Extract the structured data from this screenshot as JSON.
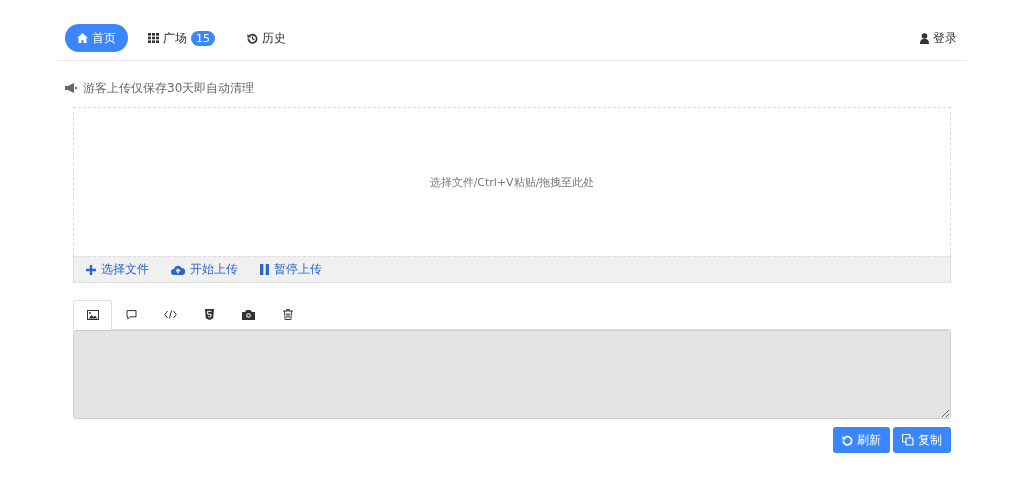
{
  "nav": {
    "items": [
      {
        "kind": "home",
        "label": "首页",
        "selected": true
      },
      {
        "kind": "grid",
        "label": "广场",
        "badge": "15",
        "selected": false
      },
      {
        "kind": "history",
        "label": "历史",
        "selected": false
      }
    ],
    "login": {
      "kind": "user",
      "label": "登录"
    }
  },
  "notice": {
    "kind": "megaphone",
    "text": "游客上传仅保存30天即自动清理"
  },
  "uploader": {
    "hint": "选择文件/Ctrl+V粘贴/拖拽至此处",
    "actions": [
      {
        "kind": "plus",
        "label": "选择文件"
      },
      {
        "kind": "cloud",
        "label": "开始上传"
      },
      {
        "kind": "pause",
        "label": "暂停上传"
      }
    ]
  },
  "tabs": [
    {
      "kind": "image",
      "selected": true
    },
    {
      "kind": "comment",
      "selected": false
    },
    {
      "kind": "code",
      "selected": false
    },
    {
      "kind": "html5",
      "selected": false
    },
    {
      "kind": "camera",
      "selected": false
    },
    {
      "kind": "trash",
      "selected": false
    }
  ],
  "output": {
    "disabled": true
  },
  "buttons": [
    {
      "kind": "refresh",
      "label": "刷新"
    },
    {
      "kind": "copy",
      "label": "复制"
    }
  ]
}
